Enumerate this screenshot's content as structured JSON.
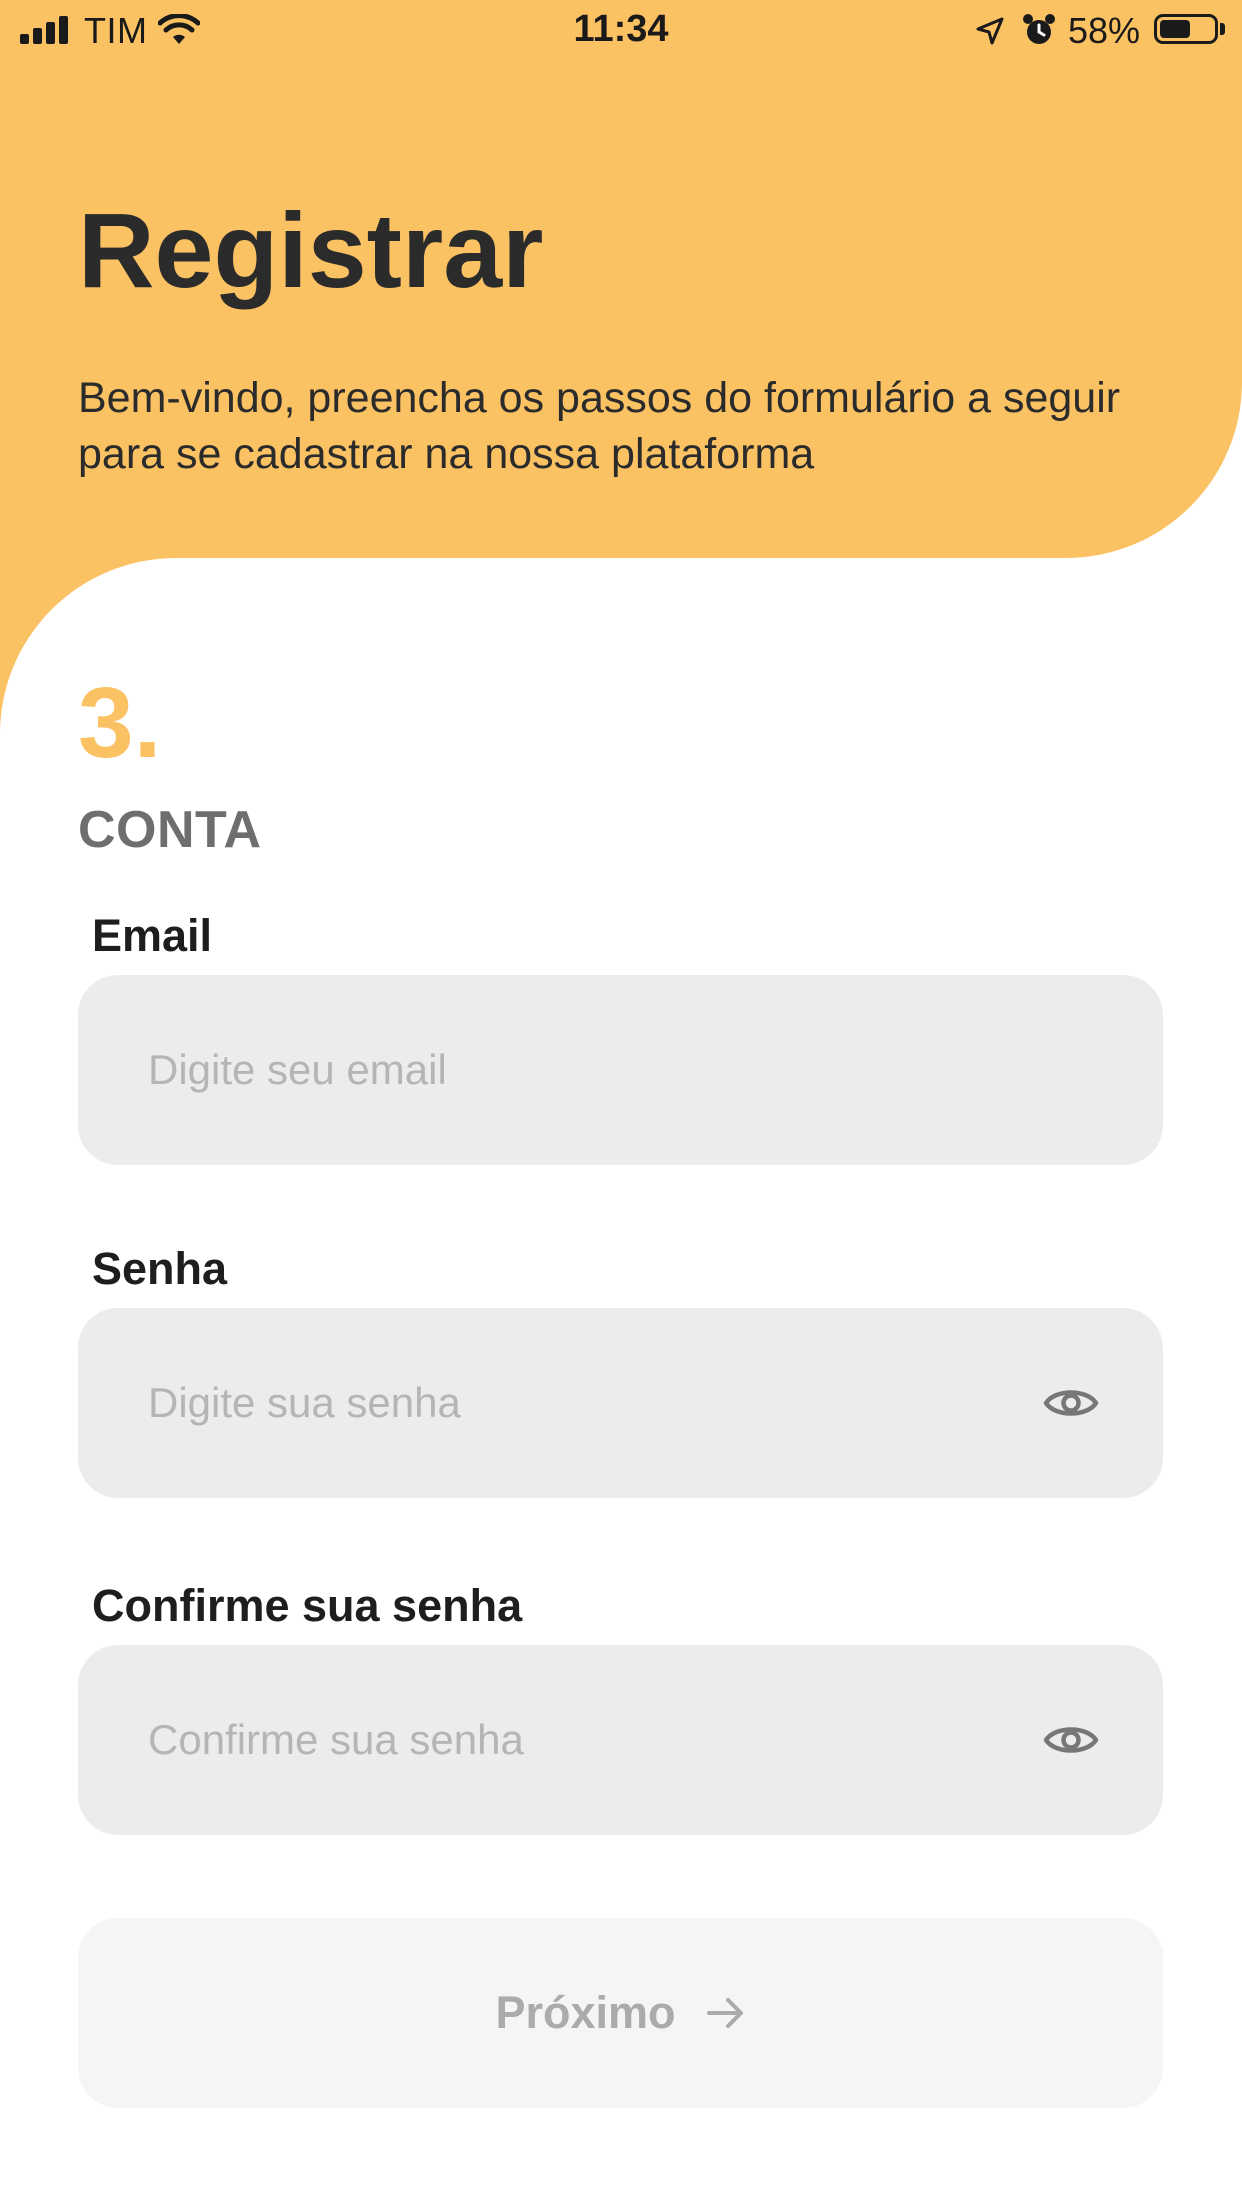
{
  "status_bar": {
    "carrier": "TIM",
    "time": "11:34",
    "battery_percent": "58%",
    "battery_level": 0.58,
    "signal_bars": 4
  },
  "header": {
    "title": "Registrar",
    "subtitle": "Bem-vindo, preencha os passos do formulário a seguir para se cadastrar na nossa plataforma"
  },
  "step": {
    "number": "3.",
    "label": "CONTA"
  },
  "form": {
    "email": {
      "label": "Email",
      "placeholder": "Digite seu email",
      "value": ""
    },
    "password": {
      "label": "Senha",
      "placeholder": "Digite sua senha",
      "value": "",
      "icon": "eye-icon"
    },
    "confirm_password": {
      "label": "Confirme sua senha",
      "placeholder": "Confirme sua senha",
      "value": "",
      "icon": "eye-icon"
    }
  },
  "next_button": {
    "label": "Próximo",
    "icon": "arrow-right-icon",
    "enabled": false
  },
  "colors": {
    "accent": "#FBC263",
    "field_background": "#ECECEC",
    "disabled_button": "#F5F5F5",
    "title_text": "#2B2B2B",
    "step_label": "#6E6E6E",
    "placeholder": "#B5B5B5"
  }
}
